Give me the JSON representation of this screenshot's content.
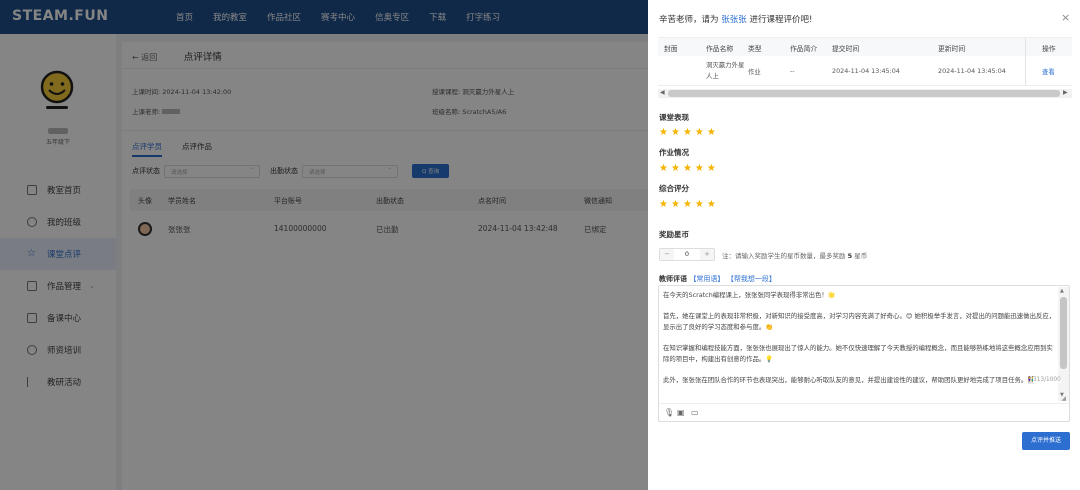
{
  "app": {
    "logo": "STEAM.FUN"
  },
  "nav": [
    "首页",
    "我的教室",
    "作品社区",
    "赛考中心",
    "信奥专区",
    "下载",
    "打字练习"
  ],
  "sidebar": {
    "user_role": "五年级下",
    "items": [
      {
        "label": "教室首页",
        "icon": "monitor-icon"
      },
      {
        "label": "我的班级",
        "icon": "user-icon"
      },
      {
        "label": "课堂点评",
        "icon": "star-icon",
        "active": true
      },
      {
        "label": "作品管理",
        "icon": "image-icon",
        "expandable": true
      },
      {
        "label": "备课中心",
        "icon": "document-icon"
      },
      {
        "label": "师资培训",
        "icon": "play-icon"
      },
      {
        "label": "教研活动",
        "icon": "flag-icon"
      }
    ]
  },
  "main": {
    "back": "← 返回",
    "title": "点评详情",
    "class_time_label": "上课时间:",
    "class_time": "2024-11-04 13:42:00",
    "course_label": "授课课程:",
    "course": "洞灭赢力外星人上",
    "teacher_label": "上课老师:",
    "class_label": "班级名称:",
    "class_name": "ScratchA5/A6",
    "tabs": [
      "点评学员",
      "点评作品"
    ],
    "filter_status_label": "点评状态",
    "filter_status_placeholder": "请选择",
    "filter_attend_label": "出勤状态",
    "filter_attend_placeholder": "请选择",
    "query_button": "Q 查询",
    "columns": [
      "头像",
      "学员姓名",
      "平台账号",
      "出勤状态",
      "点名时间",
      "微信通知"
    ],
    "rows": [
      {
        "name": "张张张",
        "account": "14100000000",
        "attendance": "已出勤",
        "time": "2024-11-04 13:42:48",
        "notify": "已绑定"
      }
    ]
  },
  "drawer": {
    "title_prefix": "辛苦老师，请为",
    "student": "张张张",
    "title_suffix": "进行课程评价吧!",
    "close": "×",
    "table_columns": [
      "封面",
      "作品名称",
      "类型",
      "作品简介",
      "提交时间",
      "更新时间",
      "操作"
    ],
    "table_row": {
      "name": "洞灭赢力外星人上",
      "type": "作业",
      "intro": "--",
      "submitted": "2024-11-04 13:45:04",
      "updated": "2024-11-04 13:45:04",
      "action": "查看"
    },
    "sections": [
      {
        "label": "课堂表现",
        "stars": 5
      },
      {
        "label": "作业情况",
        "stars": 5
      },
      {
        "label": "综合评分",
        "stars": 5
      }
    ],
    "reward_label": "奖励星币",
    "reward_value": "0",
    "reward_minus": "−",
    "reward_plus": "+",
    "reward_note_prefix": "注：请输入奖励学生的星币数量，最多奖励",
    "reward_max": "5",
    "reward_note_suffix": "星币",
    "comment_label": "教师评语",
    "common_phrases": "【常用语】",
    "help_write": "【帮我想一段】",
    "comment_paragraphs": [
      "在今天的Scratch编程课上，张张张同学表现得非常出色！🌟",
      "首先，她在课堂上的表现非常积极，对新知识的接受度高，对学习内容充满了好奇心。😊 她积极举手发言，对提出的问题能迅速做出反应，显示出了良好的学习态度和参与度。👏",
      "在知识掌握和编程技能方面，张张张也展现出了惊人的能力。她不仅快速理解了今天教授的编程概念，而且能够熟练地将这些概念应用到实际的项目中，构建出有创意的作品。💡",
      "此外，张张张在团队合作的环节也表现突出，能够耐心听取队友的意见，并提出建设性的建议，帮助团队更好地完成了项目任务。👫"
    ],
    "counter": "313/1000",
    "submit": "点评并推送"
  }
}
